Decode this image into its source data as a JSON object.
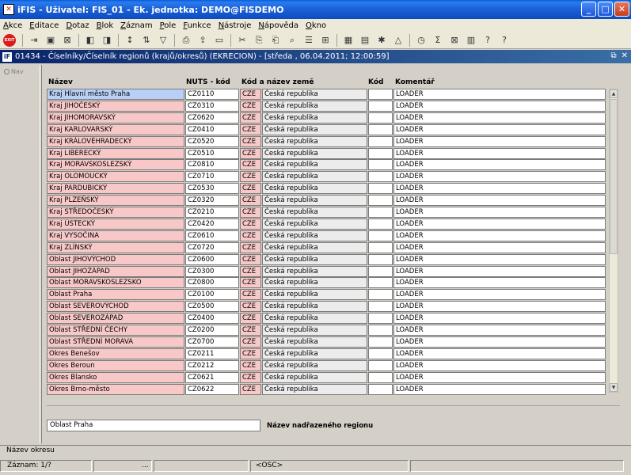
{
  "window": {
    "title": "iFIS - Uživatel: FIS_01 - Ek. jednotka: DEMO@FISDEMO",
    "app_icon": "iFIS"
  },
  "menu": [
    "Akce",
    "Editace",
    "Dotaz",
    "Blok",
    "Záznam",
    "Pole",
    "Funkce",
    "Nástroje",
    "Nápověda",
    "Okno"
  ],
  "toolbar": {
    "exit_label": "EXIT"
  },
  "inner_window": {
    "title": "01434 - Číselníky/Číselník regionů (krajů/okresů) (EKRECION) - [středa , 06.04.2011; 12:00:59]",
    "icon": "iF"
  },
  "nav": {
    "label": "Nav"
  },
  "headers": {
    "name": "Název",
    "nuts": "NUTS - kód",
    "country": "Kód a název země",
    "kod": "Kód",
    "comment": "Komentář"
  },
  "rows": [
    {
      "name": "Kraj Hlavní město Praha",
      "nuts": "CZ0110",
      "code": "CZE",
      "country": "Česká republika",
      "kod": "",
      "comment": "LOADER"
    },
    {
      "name": "Kraj JIHOČESKÝ",
      "nuts": "CZ0310",
      "code": "CZE",
      "country": "Česká republika",
      "kod": "",
      "comment": "LOADER"
    },
    {
      "name": "Kraj JIHOMORAVSKÝ",
      "nuts": "CZ0620",
      "code": "CZE",
      "country": "Česká republika",
      "kod": "",
      "comment": "LOADER"
    },
    {
      "name": "Kraj KARLOVARSKÝ",
      "nuts": "CZ0410",
      "code": "CZE",
      "country": "Česká republika",
      "kod": "",
      "comment": "LOADER"
    },
    {
      "name": "Kraj KRÁLOVÉHRADECKÝ",
      "nuts": "CZ0520",
      "code": "CZE",
      "country": "Česká republika",
      "kod": "",
      "comment": "LOADER"
    },
    {
      "name": "Kraj LIBERECKÝ",
      "nuts": "CZ0510",
      "code": "CZE",
      "country": "Česká republika",
      "kod": "",
      "comment": "LOADER"
    },
    {
      "name": "Kraj MORAVSKOSLEZSKÝ",
      "nuts": "CZ0810",
      "code": "CZE",
      "country": "Česká republika",
      "kod": "",
      "comment": "LOADER"
    },
    {
      "name": "Kraj OLOMOUCKÝ",
      "nuts": "CZ0710",
      "code": "CZE",
      "country": "Česká republika",
      "kod": "",
      "comment": "LOADER"
    },
    {
      "name": "Kraj PARDUBICKÝ",
      "nuts": "CZ0530",
      "code": "CZE",
      "country": "Česká republika",
      "kod": "",
      "comment": "LOADER"
    },
    {
      "name": "Kraj PLZEŇSKÝ",
      "nuts": "CZ0320",
      "code": "CZE",
      "country": "Česká republika",
      "kod": "",
      "comment": "LOADER"
    },
    {
      "name": "Kraj STŘEDOČESKÝ",
      "nuts": "CZ0210",
      "code": "CZE",
      "country": "Česká republika",
      "kod": "",
      "comment": "LOADER"
    },
    {
      "name": "Kraj ÚSTECKÝ",
      "nuts": "CZ0420",
      "code": "CZE",
      "country": "Česká republika",
      "kod": "",
      "comment": "LOADER"
    },
    {
      "name": "Kraj VYSOČINA",
      "nuts": "CZ0610",
      "code": "CZE",
      "country": "Česká republika",
      "kod": "",
      "comment": "LOADER"
    },
    {
      "name": "Kraj ZLÍNSKÝ",
      "nuts": "CZ0720",
      "code": "CZE",
      "country": "Česká republika",
      "kod": "",
      "comment": "LOADER"
    },
    {
      "name": "Oblast JIHOVÝCHOD",
      "nuts": "CZ0600",
      "code": "CZE",
      "country": "Česká republika",
      "kod": "",
      "comment": "LOADER"
    },
    {
      "name": "Oblast JIHOZÁPAD",
      "nuts": "CZ0300",
      "code": "CZE",
      "country": "Česká republika",
      "kod": "",
      "comment": "LOADER"
    },
    {
      "name": "Oblast MORAVSKOSLEZSKO",
      "nuts": "CZ0800",
      "code": "CZE",
      "country": "Česká republika",
      "kod": "",
      "comment": "LOADER"
    },
    {
      "name": "Oblast Praha",
      "nuts": "CZ0100",
      "code": "CZE",
      "country": "Česká republika",
      "kod": "",
      "comment": "LOADER"
    },
    {
      "name": "Oblast SEVEROVÝCHOD",
      "nuts": "CZ0500",
      "code": "CZE",
      "country": "Česká republika",
      "kod": "",
      "comment": "LOADER"
    },
    {
      "name": "Oblast SEVEROZÁPAD",
      "nuts": "CZ0400",
      "code": "CZE",
      "country": "Česká republika",
      "kod": "",
      "comment": "LOADER"
    },
    {
      "name": "Oblast STŘEDNÍ ČECHY",
      "nuts": "CZ0200",
      "code": "CZE",
      "country": "Česká republika",
      "kod": "",
      "comment": "LOADER"
    },
    {
      "name": "Oblast STŘEDNÍ MORAVA",
      "nuts": "CZ0700",
      "code": "CZE",
      "country": "Česká republika",
      "kod": "",
      "comment": "LOADER"
    },
    {
      "name": "Okres Benešov",
      "nuts": "CZ0211",
      "code": "CZE",
      "country": "Česká republika",
      "kod": "",
      "comment": "LOADER"
    },
    {
      "name": "Okres Beroun",
      "nuts": "CZ0212",
      "code": "CZE",
      "country": "Česká republika",
      "kod": "",
      "comment": "LOADER"
    },
    {
      "name": "Okres Blansko",
      "nuts": "CZ0621",
      "code": "CZE",
      "country": "Česká republika",
      "kod": "",
      "comment": "LOADER"
    },
    {
      "name": "Okres Brno-město",
      "nuts": "CZ0622",
      "code": "CZE",
      "country": "Česká republika",
      "kod": "",
      "comment": "LOADER"
    }
  ],
  "parent_region": {
    "value": "Oblast Praha",
    "label": "Název nadřazeného regionu"
  },
  "status": {
    "hint": "Název okresu",
    "record": "Záznam: 1/?",
    "dots": "...",
    "osc": "<OSC>"
  },
  "colors": {
    "required_field": "#f8c8c8",
    "selected_field": "#b8d0f8",
    "title_blue": "#0d4cc0"
  }
}
